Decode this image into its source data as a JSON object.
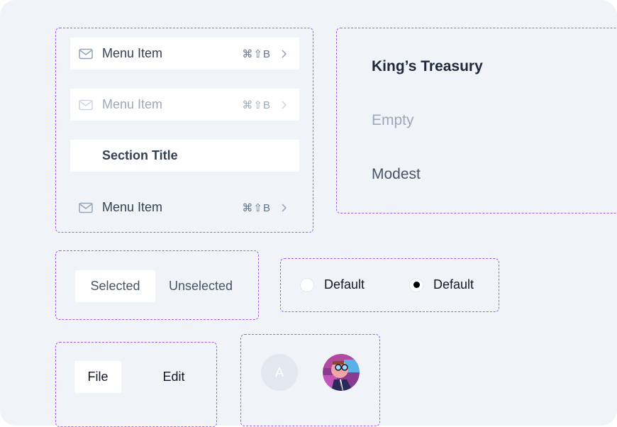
{
  "menu": {
    "items": [
      {
        "label": "Menu Item",
        "shortcut": "⌘⇧B",
        "icon": "mail-icon",
        "state": "default"
      },
      {
        "label": "Menu Item",
        "shortcut": "⌘⇧B",
        "icon": "mail-icon",
        "state": "disabled"
      },
      {
        "label": "Menu Item",
        "shortcut": "⌘⇧B",
        "icon": "mail-icon",
        "state": "default"
      }
    ],
    "section_title": "Section Title"
  },
  "text_styles": {
    "heading": "King’s Treasury",
    "empty": "Empty",
    "modest": "Modest"
  },
  "segmented": {
    "selected": "Selected",
    "unselected": "Unselected"
  },
  "radios": [
    {
      "label": "Default",
      "checked": false
    },
    {
      "label": "Default",
      "checked": true
    }
  ],
  "menubar": {
    "items": [
      "File",
      "Edit"
    ]
  },
  "avatars": {
    "fallback_initial": "A",
    "image_alt": "user-avatar-illustration"
  },
  "colors": {
    "frame_border": "#a45cf0",
    "background": "#f0f3f8",
    "text_primary": "#334155",
    "text_muted": "#9ca9ba"
  }
}
